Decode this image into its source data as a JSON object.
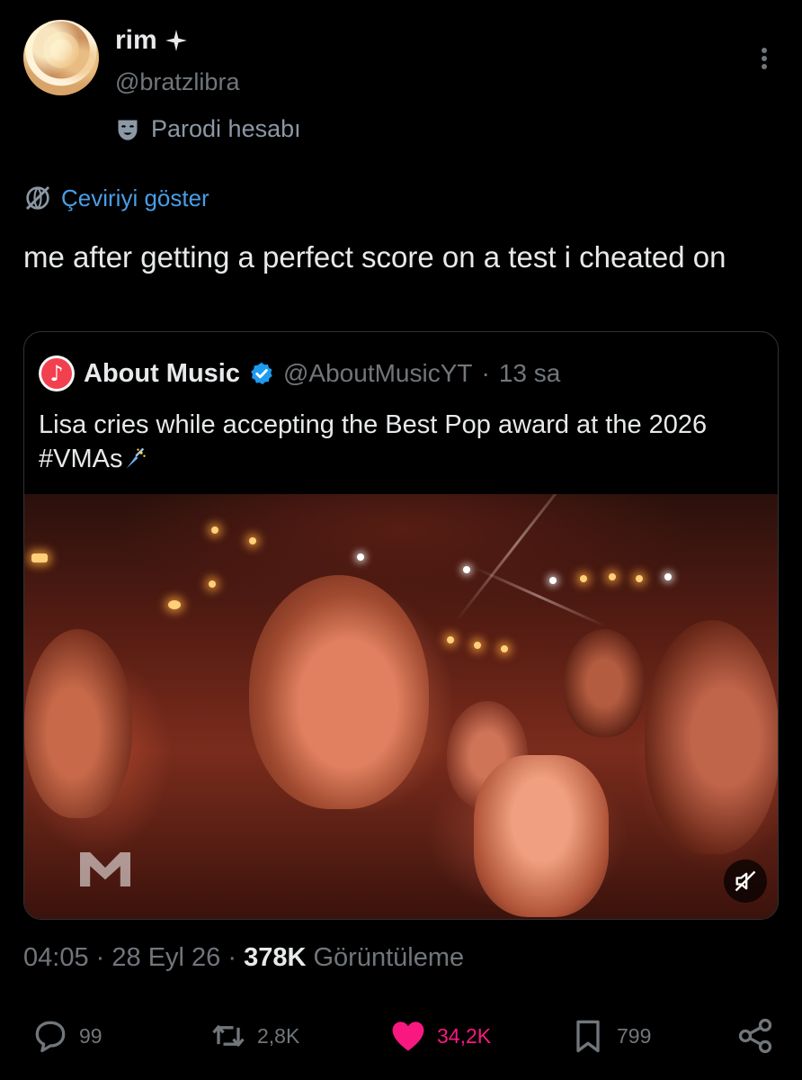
{
  "tweet": {
    "author": {
      "display_name": "rim",
      "handle": "@bratzlibra",
      "badge_icon": "sparkle-star-icon",
      "label": "Parodi hesabı",
      "label_icon": "theater-mask-icon"
    },
    "translate_label": "Çeviriyi göster",
    "text": "me after getting a perfect score on a test i cheated on",
    "meta": {
      "time": "04:05",
      "separator": "·",
      "date": "28 Eyl 26",
      "views_count": "378K",
      "views_label": "Görüntüleme"
    },
    "actions": {
      "replies": "99",
      "reposts": "2,8K",
      "likes": "34,2K",
      "bookmarks": "799"
    }
  },
  "quote": {
    "avatar_glyph": "♪",
    "name": "About Music",
    "handle": "@AboutMusicYT",
    "separator": "·",
    "time": "13 sa",
    "text": "Lisa cries while accepting the Best Pop award at the 2026 #VMAs",
    "emoji_icon": "sparkle-emoji-icon",
    "media": {
      "watermark": "MTV",
      "mute_icon": "speaker-muted-icon"
    }
  },
  "colors": {
    "background": "#000000",
    "text_primary": "#e7e9ea",
    "text_secondary": "#71767b",
    "link": "#4a9de6",
    "verified": "#1d9bf0",
    "like": "#f91880",
    "border": "#2f3336"
  }
}
